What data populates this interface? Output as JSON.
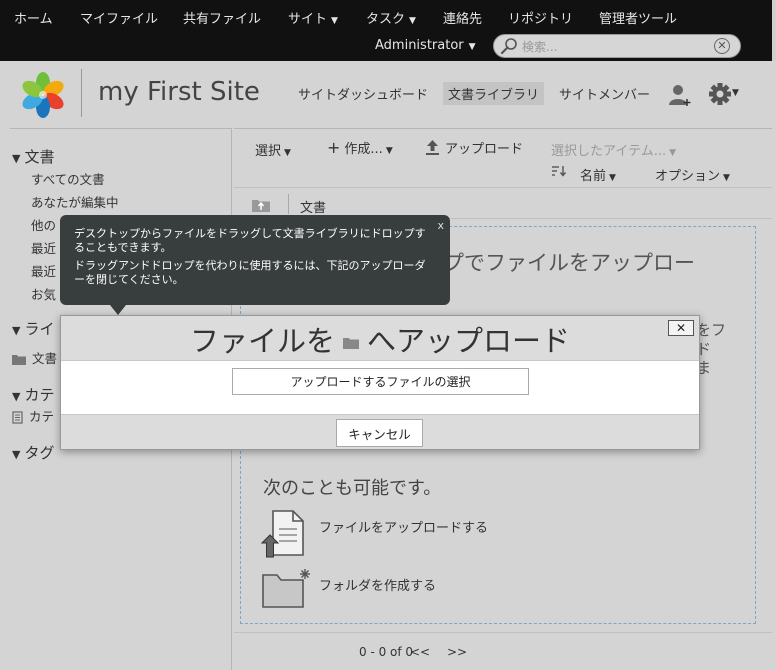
{
  "topnav": {
    "items": [
      "ホーム",
      "マイファイル",
      "共有ファイル",
      "サイト",
      "タスク",
      "連絡先",
      "リポジトリ",
      "管理者ツール"
    ],
    "user": "Administrator",
    "search_placeholder": "検索..."
  },
  "site": {
    "title": "my First Site",
    "nav": [
      "サイトダッシュボード",
      "文書ライブラリ",
      "サイトメンバー"
    ],
    "active_nav": "文書ライブラリ"
  },
  "sidebar": {
    "documents_head": "文書",
    "documents_items": [
      "すべての文書",
      "あなたが編集中",
      "他の",
      "最近",
      "最近",
      "お気"
    ],
    "library_head": "ライ",
    "library_item": "文書",
    "categories_head": "カテ",
    "categories_item": "カテ",
    "tags_head": "タグ"
  },
  "toolbar": {
    "select": "選択",
    "create": "作成...",
    "upload": "アップロード",
    "selected_items": "選択したアイテム...",
    "sort_name": "名前",
    "options": "オプション"
  },
  "path": {
    "label": "文書"
  },
  "dropzone": {
    "title": "ロップでファイルをアップロー",
    "side_text_1": "をフ",
    "side_text_2": "ド",
    "side_text_3": "ま",
    "also_title": "次のことも可能です。",
    "upload_action": "ファイルをアップロードする",
    "folder_action": "フォルダを作成する"
  },
  "pagination": {
    "info": "0 - 0 of 0",
    "prev": "<<",
    "next": ">>"
  },
  "tooltip": {
    "line1": "デスクトップからファイルをドラッグして文書ライブラリにドロップすることもできます。",
    "line2": "ドラッグアンドドロップを代わりに使用するには、下記のアップローダーを閉じてください。",
    "close": "x"
  },
  "dialog": {
    "title_part1": "ファイルを",
    "title_part2": "へアップロード",
    "close": "✕",
    "select_files": "アップロードするファイルの選択",
    "cancel": "キャンセル"
  },
  "colors": {
    "topbar_bg": "#111111",
    "page_bg": "#d4d4d4",
    "tooltip_bg": "#383d3d",
    "dropzone_border": "#7fa6c8"
  }
}
